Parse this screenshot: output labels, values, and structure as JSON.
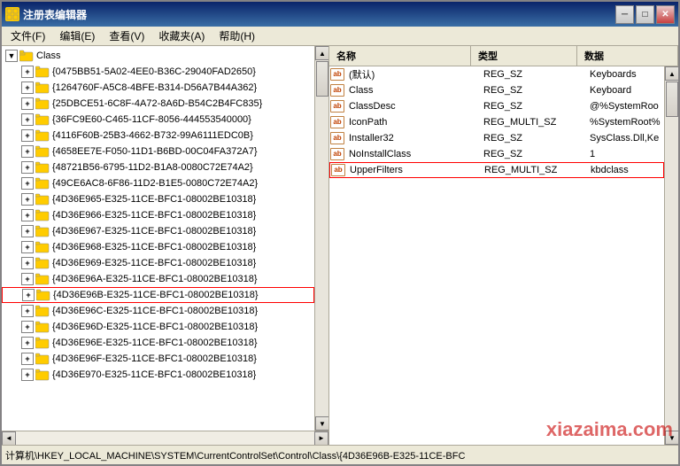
{
  "window": {
    "title": "注册表编辑器",
    "close_btn": "✕",
    "min_btn": "─",
    "max_btn": "□"
  },
  "menu": {
    "items": [
      "文件(F)",
      "编辑(E)",
      "查看(V)",
      "收藏夹(A)",
      "帮助(H)"
    ]
  },
  "tree": {
    "root_label": "Class",
    "nodes": [
      "{0475BB51-5A02-4EE0-B36C-29040FAD2650}",
      "{1264760F-A5C8-4BFE-B314-D56A7B44A362}",
      "{25DBCE51-6C8F-4A72-8A6D-B54C2B4FC835}",
      "{36FC9E60-C465-11CF-8056-444553540000}",
      "{4116F60B-25B3-4662-B732-99A6111EDC0B}",
      "{4658EE7E-F050-11D1-B6BD-00C04FA372A7}",
      "{48721B56-6795-11D2-B1A8-0080C72E74A2}",
      "{49CE6AC8-6F86-11D2-B1E5-0080C72E74A2}",
      "{4D36E965-E325-11CE-BFC1-08002BE10318}",
      "{4D36E966-E325-11CE-BFC1-08002BE10318}",
      "{4D36E967-E325-11CE-BFC1-08002BE10318}",
      "{4D36E968-E325-11CE-BFC1-08002BE10318}",
      "{4D36E969-E325-11CE-BFC1-08002BE10318}",
      "{4D36E96A-E325-11CE-BFC1-08002BE10318}",
      "{4D36E96B-E325-11CE-BFC1-08002BE10318}",
      "{4D36E96C-E325-11CE-BFC1-08002BE10318}",
      "{4D36E96D-E325-11CE-BFC1-08002BE10318}",
      "{4D36E96E-E325-11CE-BFC1-08002BE10318}",
      "{4D36E96F-E325-11CE-BFC1-08002BE10318}",
      "{4D36E970-E325-11CE-BFC1-08002BE10318}"
    ],
    "highlighted_index": 14
  },
  "registry": {
    "columns": [
      "名称",
      "类型",
      "数据"
    ],
    "items": [
      {
        "name": "(默认)",
        "type": "REG_SZ",
        "data": "Keyboards"
      },
      {
        "name": "Class",
        "type": "REG_SZ",
        "data": "Keyboard"
      },
      {
        "name": "ClassDesc",
        "type": "REG_SZ",
        "data": "@%SystemRoo"
      },
      {
        "name": "IconPath",
        "type": "REG_MULTI_SZ",
        "data": "%SystemRoot%"
      },
      {
        "name": "Installer32",
        "type": "REG_SZ",
        "data": "SysClass.Dll,Ke"
      },
      {
        "name": "NoInstallClass",
        "type": "REG_SZ",
        "data": "1"
      },
      {
        "name": "UpperFilters",
        "type": "REG_MULTI_SZ",
        "data": "kbdclass"
      }
    ],
    "highlighted_index": 6
  },
  "status": {
    "text": "计算机\\HKEY_LOCAL_MACHINE\\SYSTEM\\CurrentControlSet\\Control\\Class\\{4D36E96B-E325-11CE-BFC"
  },
  "watermark": "xiazaima.com"
}
